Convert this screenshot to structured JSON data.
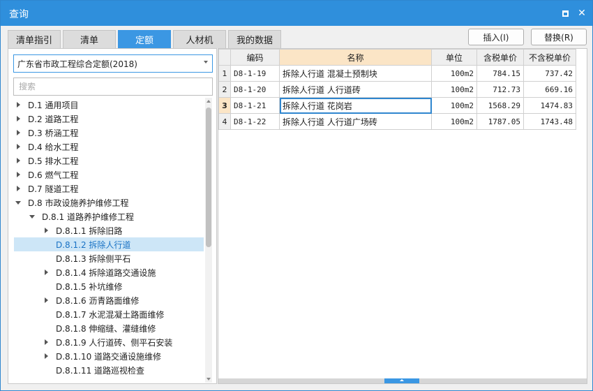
{
  "window": {
    "title": "查询"
  },
  "tabs": [
    {
      "label": "清单指引"
    },
    {
      "label": "清单"
    },
    {
      "label": "定额"
    },
    {
      "label": "人材机"
    },
    {
      "label": "我的数据"
    }
  ],
  "active_tab": "定额",
  "actions": {
    "insert_label": "插入(I)",
    "replace_label": "替换(R)"
  },
  "library": {
    "selected": "广东省市政工程综合定额(2018)"
  },
  "search": {
    "placeholder": "搜索",
    "value": ""
  },
  "tree": [
    {
      "label": "D.1 通用项目",
      "expand": "collapsed"
    },
    {
      "label": "D.2 道路工程",
      "expand": "collapsed"
    },
    {
      "label": "D.3 桥涵工程",
      "expand": "collapsed"
    },
    {
      "label": "D.4 给水工程",
      "expand": "collapsed"
    },
    {
      "label": "D.5 排水工程",
      "expand": "collapsed"
    },
    {
      "label": "D.6 燃气工程",
      "expand": "collapsed"
    },
    {
      "label": "D.7 隧道工程",
      "expand": "collapsed"
    },
    {
      "label": "D.8 市政设施养护维修工程",
      "expand": "expanded"
    },
    {
      "label": "D.8.1 道路养护维修工程",
      "expand": "expanded"
    },
    {
      "label": "D.8.1.1 拆除旧路",
      "expand": "collapsed"
    },
    {
      "label": "D.8.1.2 拆除人行道",
      "expand": "none",
      "selected": true
    },
    {
      "label": "D.8.1.3 拆除侧平石",
      "expand": "none"
    },
    {
      "label": "D.8.1.4 拆除道路交通设施",
      "expand": "collapsed"
    },
    {
      "label": "D.8.1.5 补坑维修",
      "expand": "none"
    },
    {
      "label": "D.8.1.6 沥青路面维修",
      "expand": "collapsed"
    },
    {
      "label": "D.8.1.7 水泥混凝土路面维修",
      "expand": "none"
    },
    {
      "label": "D.8.1.8 伸缩缝、灌缝维修",
      "expand": "none"
    },
    {
      "label": "D.8.1.9 人行道砖、侧平石安装",
      "expand": "collapsed"
    },
    {
      "label": "D.8.1.10 道路交通设施维修",
      "expand": "collapsed"
    },
    {
      "label": "D.8.1.11 道路巡视检查",
      "expand": "none"
    }
  ],
  "table": {
    "headers": {
      "code": "编码",
      "name": "名称",
      "unit": "单位",
      "price_tax": "含税单价",
      "price_notax": "不含税单价"
    },
    "rows": [
      {
        "num": "1",
        "code": "D8-1-19",
        "name": "拆除人行道 混凝土预制块",
        "unit": "100m2",
        "price_tax": "784.15",
        "price_notax": "737.42"
      },
      {
        "num": "2",
        "code": "D8-1-20",
        "name": "拆除人行道 人行道砖",
        "unit": "100m2",
        "price_tax": "712.73",
        "price_notax": "669.16"
      },
      {
        "num": "3",
        "code": "D8-1-21",
        "name": "拆除人行道 花岗岩",
        "unit": "100m2",
        "price_tax": "1568.29",
        "price_notax": "1474.83"
      },
      {
        "num": "4",
        "code": "D8-1-22",
        "name": "拆除人行道 人行道广场砖",
        "unit": "100m2",
        "price_tax": "1787.05",
        "price_notax": "1743.48"
      }
    ],
    "active_row": "3"
  },
  "colors": {
    "titlebar": "#2f8fdc",
    "accent": "#3b97e3",
    "selection": "#cde6f7",
    "header_highlight": "#fbe5c6"
  }
}
